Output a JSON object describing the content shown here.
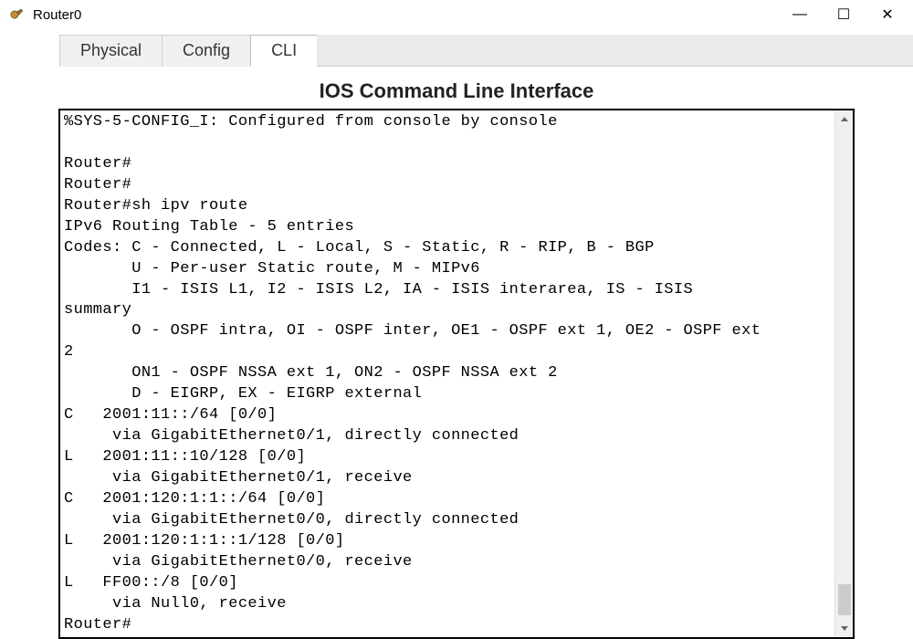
{
  "window": {
    "title": "Router0"
  },
  "tabs": {
    "physical": "Physical",
    "config": "Config",
    "cli": "CLI"
  },
  "cli": {
    "heading": "IOS Command Line Interface",
    "lines": [
      "%SYS-5-CONFIG_I: Configured from console by console",
      "",
      "Router#",
      "Router#",
      "Router#sh ipv route",
      "IPv6 Routing Table - 5 entries",
      "Codes: C - Connected, L - Local, S - Static, R - RIP, B - BGP",
      "       U - Per-user Static route, M - MIPv6",
      "       I1 - ISIS L1, I2 - ISIS L2, IA - ISIS interarea, IS - ISIS",
      "summary",
      "       O - OSPF intra, OI - OSPF inter, OE1 - OSPF ext 1, OE2 - OSPF ext",
      "2",
      "       ON1 - OSPF NSSA ext 1, ON2 - OSPF NSSA ext 2",
      "       D - EIGRP, EX - EIGRP external",
      "C   2001:11::/64 [0/0]",
      "     via GigabitEthernet0/1, directly connected",
      "L   2001:11::10/128 [0/0]",
      "     via GigabitEthernet0/1, receive",
      "C   2001:120:1:1::/64 [0/0]",
      "     via GigabitEthernet0/0, directly connected",
      "L   2001:120:1:1::1/128 [0/0]",
      "     via GigabitEthernet0/0, receive",
      "L   FF00::/8 [0/0]",
      "     via Null0, receive",
      "Router#"
    ]
  }
}
